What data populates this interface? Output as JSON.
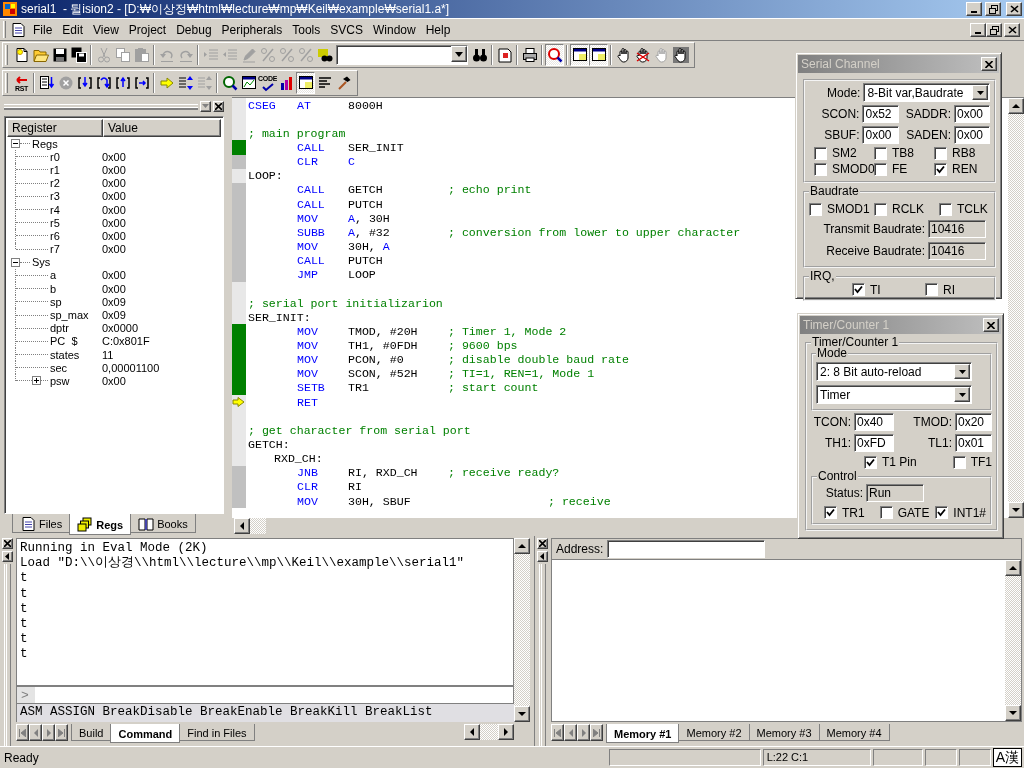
{
  "window": {
    "title": "serial1  - 뒬ision2 - [D:₩이상정₩html₩lecture₩mp₩Keil₩example₩serial1.a*]"
  },
  "menu": [
    "File",
    "Edit",
    "View",
    "Project",
    "Debug",
    "Peripherals",
    "Tools",
    "SVCS",
    "Window",
    "Help"
  ],
  "toolbar_1": [
    {
      "kind": "new-file",
      "pressed": false,
      "disabled": false
    },
    {
      "kind": "open",
      "pressed": false,
      "disabled": false
    },
    {
      "kind": "save",
      "pressed": false,
      "disabled": false
    },
    {
      "kind": "save-all",
      "pressed": false,
      "disabled": false
    },
    {
      "kind": "separator"
    },
    {
      "kind": "cut",
      "pressed": false,
      "disabled": true
    },
    {
      "kind": "copy",
      "pressed": false,
      "disabled": true
    },
    {
      "kind": "paste",
      "pressed": false,
      "disabled": true
    },
    {
      "kind": "separator"
    },
    {
      "kind": "undo",
      "pressed": false,
      "disabled": true
    },
    {
      "kind": "redo",
      "pressed": false,
      "disabled": true
    },
    {
      "kind": "separator"
    },
    {
      "kind": "indent",
      "pressed": false,
      "disabled": true
    },
    {
      "kind": "outdent",
      "pressed": false,
      "disabled": true
    },
    {
      "kind": "bookmark-toggle",
      "pressed": false,
      "disabled": true
    },
    {
      "kind": "bookmark-next",
      "pressed": false,
      "disabled": true
    },
    {
      "kind": "bookmark-prev",
      "pressed": false,
      "disabled": true
    },
    {
      "kind": "bookmark-clear",
      "pressed": false,
      "disabled": true
    },
    {
      "kind": "find-in-files",
      "pressed": false,
      "disabled": false
    },
    {
      "kind": "combo"
    },
    {
      "kind": "find",
      "pressed": false,
      "disabled": false
    },
    {
      "kind": "separator"
    },
    {
      "kind": "open-doc",
      "pressed": false,
      "disabled": false
    },
    {
      "kind": "separator"
    },
    {
      "kind": "print",
      "pressed": false,
      "disabled": false
    },
    {
      "kind": "separator"
    },
    {
      "kind": "debug",
      "pressed": true,
      "disabled": false
    },
    {
      "kind": "separator"
    },
    {
      "kind": "window-a",
      "pressed": true,
      "disabled": false
    },
    {
      "kind": "window-b",
      "pressed": true,
      "disabled": false
    },
    {
      "kind": "separator"
    },
    {
      "kind": "hand",
      "pressed": false,
      "disabled": false
    },
    {
      "kind": "hand-cross",
      "pressed": false,
      "disabled": false
    },
    {
      "kind": "hand-grey",
      "pressed": false,
      "disabled": true
    },
    {
      "kind": "hand-stop",
      "pressed": false,
      "disabled": false
    }
  ],
  "toolbar_2": [
    {
      "kind": "reset",
      "label": "RST",
      "pressed": false,
      "disabled": false
    },
    {
      "kind": "separator"
    },
    {
      "kind": "run",
      "pressed": false,
      "disabled": false
    },
    {
      "kind": "stop",
      "pressed": false,
      "disabled": true
    },
    {
      "kind": "step-into",
      "pressed": false,
      "disabled": false
    },
    {
      "kind": "step-over",
      "pressed": false,
      "disabled": false
    },
    {
      "kind": "step-out",
      "pressed": false,
      "disabled": false
    },
    {
      "kind": "run-to-cursor",
      "pressed": false,
      "disabled": false
    },
    {
      "kind": "separator"
    },
    {
      "kind": "show-next",
      "pressed": false,
      "disabled": false
    },
    {
      "kind": "breakpoint-list",
      "pressed": false,
      "disabled": false
    },
    {
      "kind": "breakpoint-grey",
      "pressed": false,
      "disabled": true
    },
    {
      "kind": "separator"
    },
    {
      "kind": "disassembly",
      "pressed": false,
      "disabled": false
    },
    {
      "kind": "watch",
      "pressed": false,
      "disabled": false
    },
    {
      "kind": "coverage",
      "label": "CODE",
      "pressed": false,
      "disabled": false
    },
    {
      "kind": "performance",
      "pressed": false,
      "disabled": false
    },
    {
      "kind": "serial-window",
      "pressed": true,
      "disabled": false
    },
    {
      "kind": "list",
      "pressed": false,
      "disabled": false
    },
    {
      "kind": "hammer",
      "pressed": false,
      "disabled": false
    }
  ],
  "register_panel": {
    "columns": [
      "Register",
      "Value"
    ],
    "tree": [
      {
        "name": "Regs",
        "expanded": true,
        "children": [
          {
            "name": "r0",
            "value": "0x00"
          },
          {
            "name": "r1",
            "value": "0x00"
          },
          {
            "name": "r2",
            "value": "0x00"
          },
          {
            "name": "r3",
            "value": "0x00"
          },
          {
            "name": "r4",
            "value": "0x00"
          },
          {
            "name": "r5",
            "value": "0x00"
          },
          {
            "name": "r6",
            "value": "0x00"
          },
          {
            "name": "r7",
            "value": "0x00"
          }
        ]
      },
      {
        "name": "Sys",
        "expanded": true,
        "children": [
          {
            "name": "a",
            "value": "0x00"
          },
          {
            "name": "b",
            "value": "0x00"
          },
          {
            "name": "sp",
            "value": "0x09"
          },
          {
            "name": "sp_max",
            "value": "0x09"
          },
          {
            "name": "dptr",
            "value": "0x0000"
          },
          {
            "name": "PC  $",
            "value": "C:0x801F"
          },
          {
            "name": "states",
            "value": "11"
          },
          {
            "name": "sec",
            "value": "0,00001100"
          },
          {
            "name": "psw",
            "value": "0x00",
            "expanded": false
          }
        ]
      }
    ],
    "tabs": [
      {
        "label": "Files",
        "selected": false
      },
      {
        "label": "Regs",
        "selected": true
      },
      {
        "label": "Books",
        "selected": false
      }
    ]
  },
  "editor": {
    "lines": [
      {
        "kind": "directive",
        "executable": false,
        "executed": false,
        "current": false,
        "cells": [
          {
            "text": "CSEG",
            "kind": "keyword"
          },
          {
            "text": "AT",
            "kind": "keyword"
          },
          {
            "text": "8000H",
            "kind": "plain"
          }
        ]
      },
      {
        "kind": "blank",
        "executable": false,
        "executed": false,
        "current": false
      },
      {
        "kind": "comment",
        "executable": false,
        "executed": false,
        "current": false,
        "comment": "; main program"
      },
      {
        "kind": "instruction",
        "executable": true,
        "executed": true,
        "current": false,
        "op": "CALL",
        "args": [
          {
            "text": "SER_INIT",
            "kind": "plain"
          }
        ]
      },
      {
        "kind": "instruction",
        "executable": true,
        "executed": false,
        "current": false,
        "op": "CLR",
        "args": [
          {
            "text": "C",
            "kind": "keyword"
          }
        ]
      },
      {
        "kind": "label",
        "executable": false,
        "executed": false,
        "current": false,
        "label": "LOOP:"
      },
      {
        "kind": "instruction",
        "executable": true,
        "executed": false,
        "current": false,
        "op": "CALL",
        "args": [
          {
            "text": "GETCH",
            "kind": "plain"
          }
        ],
        "comment": "; echo print"
      },
      {
        "kind": "instruction",
        "executable": true,
        "executed": false,
        "current": false,
        "op": "CALL",
        "args": [
          {
            "text": "PUTCH",
            "kind": "plain"
          }
        ]
      },
      {
        "kind": "instruction",
        "executable": true,
        "executed": false,
        "current": false,
        "op": "MOV",
        "args": [
          {
            "text": "A",
            "kind": "keyword"
          },
          {
            "text": ", 30H",
            "kind": "plain"
          }
        ]
      },
      {
        "kind": "instruction",
        "executable": true,
        "executed": false,
        "current": false,
        "op": "SUBB",
        "args": [
          {
            "text": "A",
            "kind": "keyword"
          },
          {
            "text": ", #32",
            "kind": "plain"
          }
        ],
        "comment": "; conversion from lower to upper character"
      },
      {
        "kind": "instruction",
        "executable": true,
        "executed": false,
        "current": false,
        "op": "MOV",
        "args": [
          {
            "text": "30H, ",
            "kind": "plain"
          },
          {
            "text": "A",
            "kind": "keyword"
          }
        ]
      },
      {
        "kind": "instruction",
        "executable": true,
        "executed": false,
        "current": false,
        "op": "CALL",
        "args": [
          {
            "text": "PUTCH",
            "kind": "plain"
          }
        ]
      },
      {
        "kind": "instruction",
        "executable": true,
        "executed": false,
        "current": false,
        "op": "JMP",
        "args": [
          {
            "text": "LOOP",
            "kind": "plain"
          }
        ]
      },
      {
        "kind": "blank",
        "executable": false,
        "executed": false,
        "current": false
      },
      {
        "kind": "comment",
        "executable": false,
        "executed": false,
        "current": false,
        "comment": "; serial port initializarion"
      },
      {
        "kind": "label",
        "executable": false,
        "executed": false,
        "current": false,
        "label": "SER_INIT:"
      },
      {
        "kind": "instruction",
        "executable": true,
        "executed": true,
        "current": false,
        "op": "MOV",
        "args": [
          {
            "text": "TMOD, #20H",
            "kind": "plain"
          }
        ],
        "comment": "; Timer 1, Mode 2"
      },
      {
        "kind": "instruction",
        "executable": true,
        "executed": true,
        "current": false,
        "op": "MOV",
        "args": [
          {
            "text": "TH1, #0FDH",
            "kind": "plain"
          }
        ],
        "comment": "; 9600 bps"
      },
      {
        "kind": "instruction",
        "executable": true,
        "executed": true,
        "current": false,
        "op": "MOV",
        "args": [
          {
            "text": "PCON, #0",
            "kind": "plain"
          }
        ],
        "comment": "; disable double baud rate"
      },
      {
        "kind": "instruction",
        "executable": true,
        "executed": true,
        "current": false,
        "op": "MOV",
        "args": [
          {
            "text": "SCON, #52H",
            "kind": "plain"
          }
        ],
        "comment": "; TI=1, REN=1, Mode 1"
      },
      {
        "kind": "instruction",
        "executable": true,
        "executed": true,
        "current": false,
        "op": "SETB",
        "args": [
          {
            "text": "TR1",
            "kind": "plain"
          }
        ],
        "comment": "; start count"
      },
      {
        "kind": "instruction",
        "executable": false,
        "executed": false,
        "current": true,
        "op": "RET"
      },
      {
        "kind": "blank",
        "executable": false,
        "executed": false,
        "current": false
      },
      {
        "kind": "comment",
        "executable": false,
        "executed": false,
        "current": false,
        "comment": "; get character from serial port"
      },
      {
        "kind": "label",
        "executable": false,
        "executed": false,
        "current": false,
        "label": "GETCH:"
      },
      {
        "kind": "local-label",
        "executable": false,
        "executed": false,
        "current": false,
        "label": "RXD_CH:"
      },
      {
        "kind": "instruction",
        "executable": true,
        "executed": false,
        "current": false,
        "op": "JNB",
        "args": [
          {
            "text": "RI, RXD_CH",
            "kind": "plain"
          }
        ],
        "comment": "; receive ready?"
      },
      {
        "kind": "instruction",
        "executable": true,
        "executed": false,
        "current": false,
        "op": "CLR",
        "args": [
          {
            "text": "RI",
            "kind": "plain"
          }
        ]
      },
      {
        "kind": "instruction",
        "executable": true,
        "executed": false,
        "current": false,
        "op": "MOV",
        "args": [
          {
            "text": "30H, SBUF",
            "kind": "plain"
          }
        ],
        "comment": "; receive",
        "far": true
      }
    ]
  },
  "output": {
    "lines": [
      "Running in Eval Mode (2K)",
      "Load \"D:\\\\이상경\\\\html\\\\lecture\\\\mp\\\\Keil\\\\example\\\\serial1\"",
      "t",
      "t",
      "t",
      "t",
      "t",
      "t"
    ],
    "prompt": ">",
    "commands": "ASM ASSIGN BreakDisable BreakEnable BreakKill BreakList",
    "tabs": [
      {
        "label": "Build",
        "selected": false
      },
      {
        "label": "Command",
        "selected": true
      },
      {
        "label": "Find in Files",
        "selected": false
      }
    ]
  },
  "memory": {
    "address_label": "Address:",
    "tabs": [
      {
        "label": "Memory #1",
        "selected": true
      },
      {
        "label": "Memory #2",
        "selected": false
      },
      {
        "label": "Memory #3",
        "selected": false
      },
      {
        "label": "Memory #4",
        "selected": false
      }
    ]
  },
  "serial_channel": {
    "title": "Serial Channel",
    "active": false,
    "mode": {
      "label": "Mode:",
      "value": "8-Bit var,Baudrate"
    },
    "fields": [
      {
        "label": "SCON:",
        "value": "0x52",
        "readonly": false
      },
      {
        "label": "SADDR:",
        "value": "0x00",
        "readonly": false
      },
      {
        "label": "SBUF:",
        "value": "0x00",
        "readonly": false
      },
      {
        "label": "SADEN:",
        "value": "0x00",
        "readonly": false
      }
    ],
    "flags": [
      {
        "label": "SM2",
        "checked": false
      },
      {
        "label": "TB8",
        "checked": false
      },
      {
        "label": "RB8",
        "checked": false
      },
      {
        "label": "SMOD0",
        "checked": false
      },
      {
        "label": "FE",
        "checked": false
      },
      {
        "label": "REN",
        "checked": true
      }
    ],
    "baudrate": {
      "legend": "Baudrate",
      "flags": [
        {
          "label": "SMOD1",
          "checked": false
        },
        {
          "label": "RCLK",
          "checked": false
        },
        {
          "label": "TCLK",
          "checked": false
        }
      ],
      "fields": [
        {
          "label": "Transmit Baudrate:",
          "value": "10416",
          "readonly": true
        },
        {
          "label": "Receive Baudrate:",
          "value": "10416",
          "readonly": true
        }
      ]
    },
    "irq": {
      "legend": "IRQ,",
      "flags": [
        {
          "label": "TI",
          "checked": true
        },
        {
          "label": "RI",
          "checked": false
        }
      ]
    }
  },
  "timer": {
    "title": "Timer/Counter 1",
    "active": false,
    "group": "Timer/Counter 1",
    "mode": {
      "legend": "Mode",
      "selects": [
        "2: 8 Bit auto-reload",
        "Timer"
      ]
    },
    "fields": [
      {
        "label": "TCON:",
        "value": "0x40",
        "readonly": false
      },
      {
        "label": "TMOD:",
        "value": "0x20",
        "readonly": false
      },
      {
        "label": "TH1:",
        "value": "0xFD",
        "readonly": false
      },
      {
        "label": "TL1:",
        "value": "0x01",
        "readonly": false
      }
    ],
    "flags": [
      {
        "label": "T1 Pin",
        "checked": true
      },
      {
        "label": "TF1",
        "checked": false
      }
    ],
    "control": {
      "legend": "Control",
      "status": {
        "label": "Status:",
        "value": "Run",
        "readonly": true
      },
      "flags": [
        {
          "label": "TR1",
          "checked": true
        },
        {
          "label": "GATE",
          "checked": false
        },
        {
          "label": "INT1#",
          "checked": true
        }
      ]
    }
  },
  "status_bar": {
    "message": "Ready",
    "position": "L:22 C:1",
    "ime": "A漢"
  }
}
